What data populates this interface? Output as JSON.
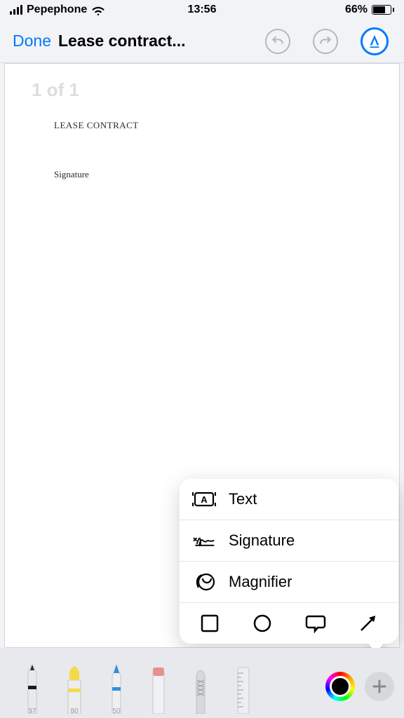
{
  "status": {
    "carrier": "Pepephone",
    "time": "13:56",
    "battery_pct": "66%"
  },
  "nav": {
    "done": "Done",
    "title": "Lease contract..."
  },
  "document": {
    "page_indicator": "1 of 1",
    "heading": "LEASE CONTRACT",
    "signature_label": "Signature"
  },
  "popup": {
    "text": "Text",
    "signature": "Signature",
    "magnifier": "Magnifier"
  },
  "tools": {
    "pen_num": "97",
    "highlighter_num": "80",
    "pencil_num": "50"
  }
}
